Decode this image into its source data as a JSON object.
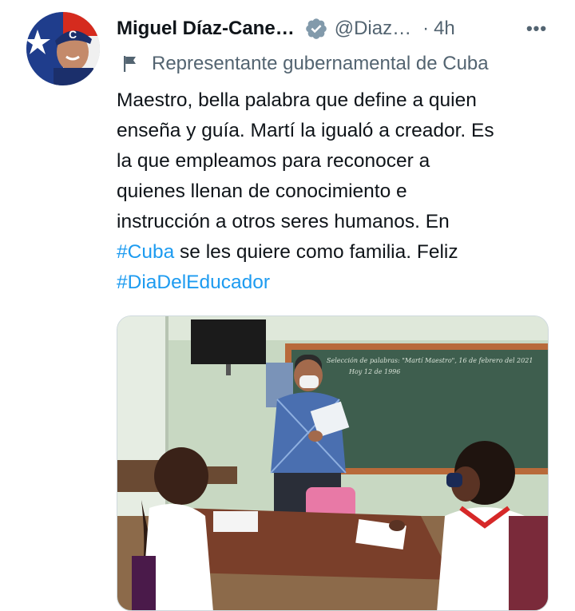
{
  "author": {
    "display_name": "Miguel Díaz-Cane…",
    "handle": "@Diaz…",
    "separator": "·",
    "time": "4h",
    "more_glyph": "•••",
    "verified_icon": "verified-badge-icon",
    "avatar_alt": "avatar"
  },
  "label": {
    "icon": "flag-icon",
    "text": "Representante gubernamental de Cuba"
  },
  "tweet": {
    "lines": [
      "Maestro, bella palabra que define a quien",
      "enseña y guía. Martí la igualó a creador. Es",
      "la que empleamos para reconocer a",
      "quienes llenan de conocimiento e",
      "instrucción a otros seres humanos. En"
    ],
    "line6_hashtag": "#Cuba",
    "line6_rest": " se les quiere como familia. Feliz",
    "line7_hashtag": "#DiaDelEducador"
  },
  "media": {
    "blackboard_line1": "Selección de palabras: \"Martí Maestro\", 16 de febrero del 2021",
    "blackboard_line2": "Hoy 12 de 1996"
  },
  "colors": {
    "text": "#0f1419",
    "secondary": "#536471",
    "link": "#1d9bf0",
    "verified": "#829aab"
  }
}
